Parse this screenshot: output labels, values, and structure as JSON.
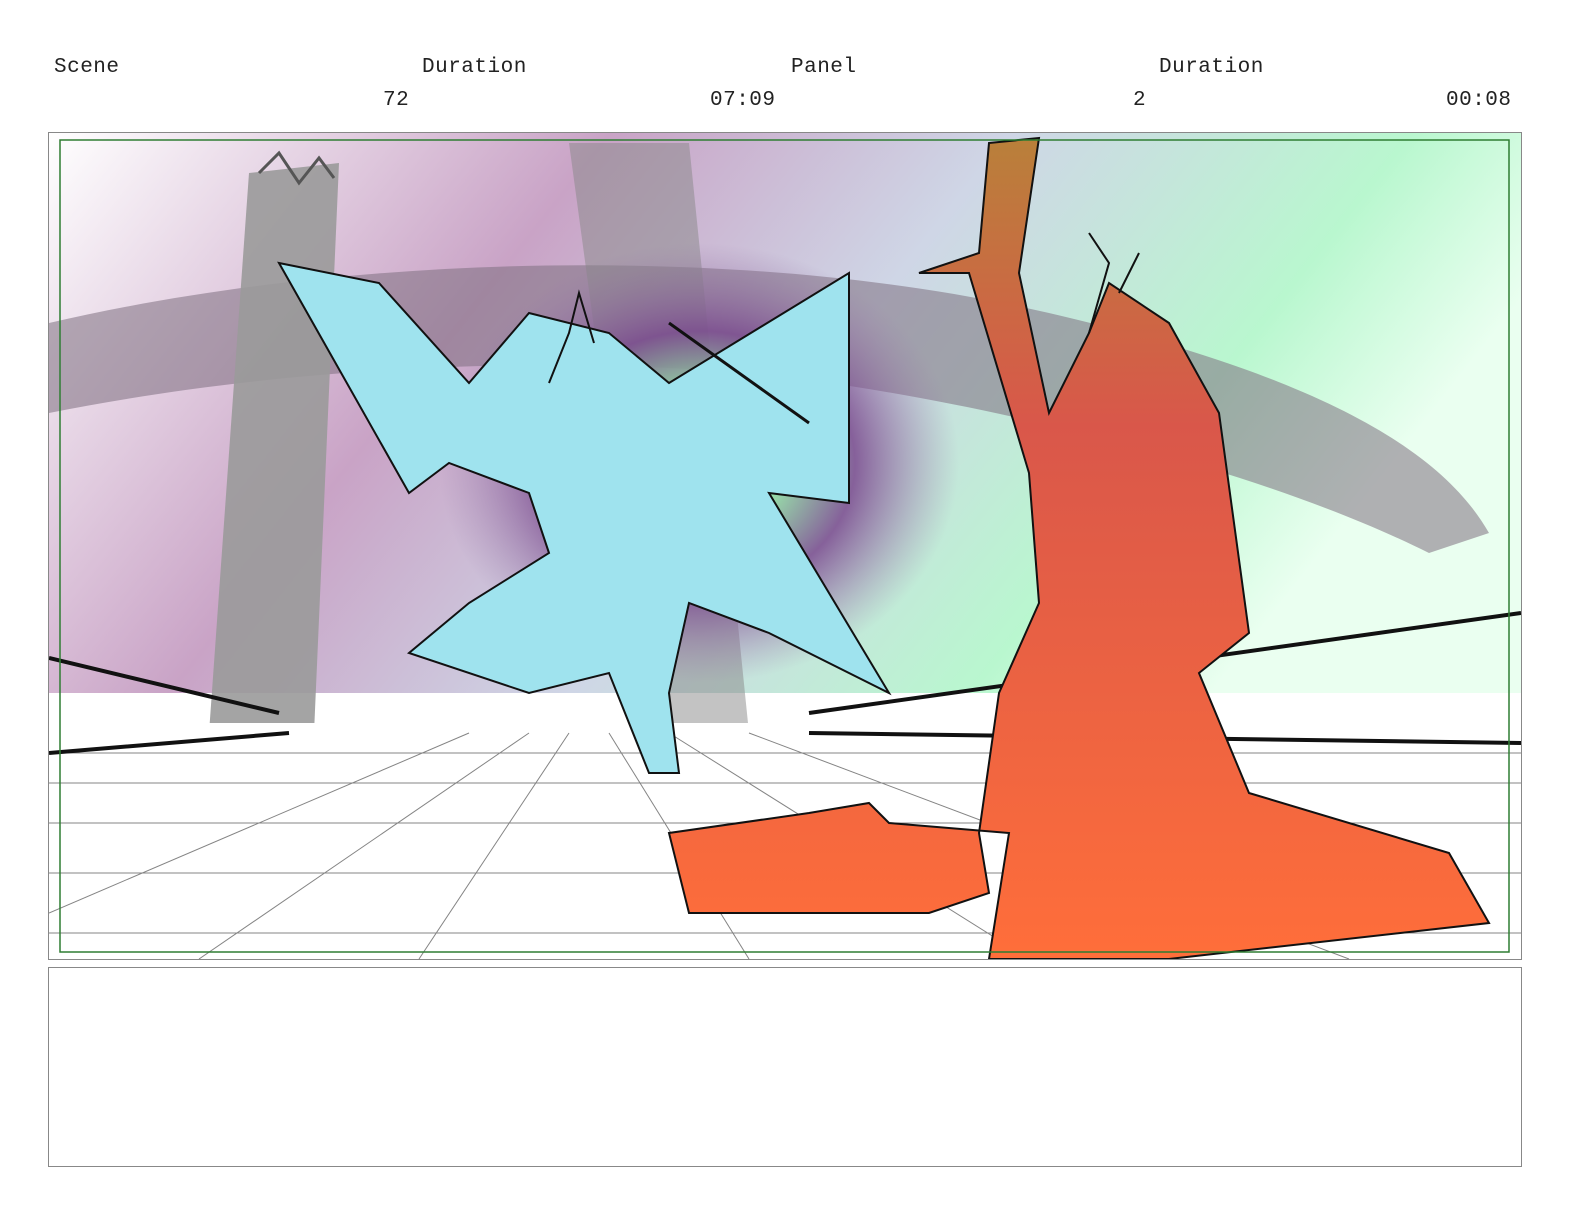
{
  "header": {
    "scene_label": "Scene",
    "scene_duration_label": "Duration",
    "panel_label": "Panel",
    "panel_duration_label": "Duration",
    "scene_number": "72",
    "scene_duration": "07:09",
    "panel_number": "2",
    "panel_duration": "00:08"
  },
  "colors": {
    "frame_guide": "#2e7d32",
    "blue_figure": "#9fe3ee",
    "red_figure": "#ff6e3a",
    "sky_purple": "#b98fb0",
    "sky_green": "#b9f7cf",
    "architecture_gray": "#9a9a9a"
  },
  "notes": {
    "text": ""
  }
}
